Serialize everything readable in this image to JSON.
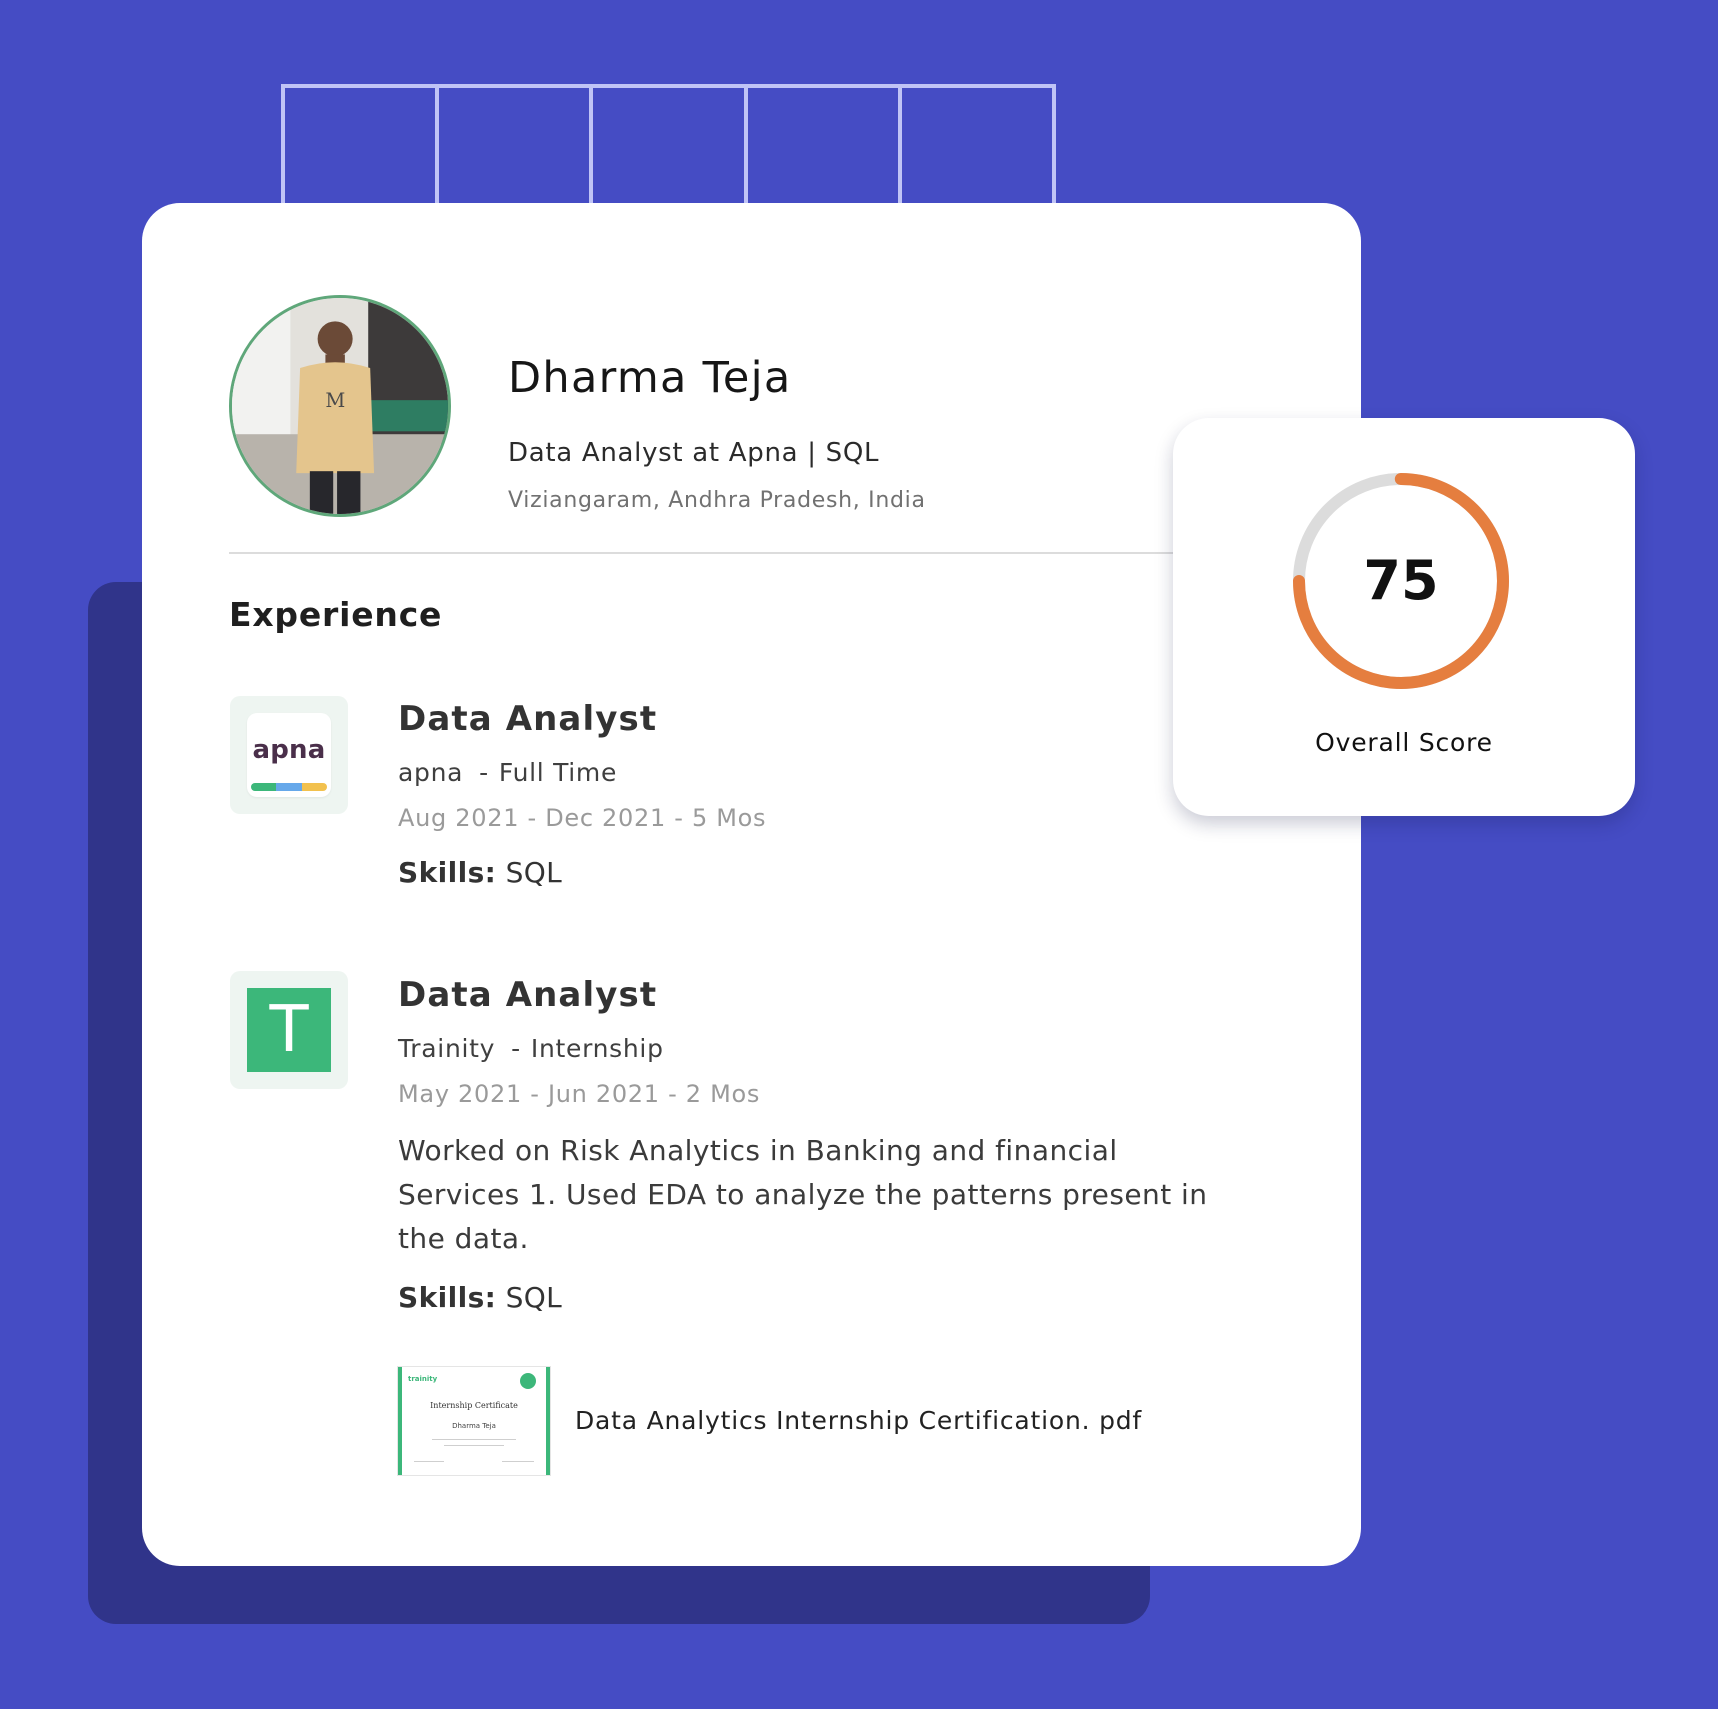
{
  "profile": {
    "name": "Dharma Teja",
    "headline": "Data Analyst at Apna | SQL",
    "location": "Viziangaram, Andhra Pradesh, India"
  },
  "experience": {
    "heading": "Experience",
    "items": [
      {
        "title": "Data Analyst",
        "company": "apna",
        "type": "Full Time",
        "dates": "Aug 2021 - Dec 2021 - 5 Mos",
        "skills_label": "Skills:",
        "skills": "SQL",
        "logo": {
          "name": "apna-logo",
          "text": "apna",
          "strip_colors": [
            "#3cb77a",
            "#66a8ea",
            "#f2c14e"
          ]
        }
      },
      {
        "title": "Data Analyst",
        "company": "Trainity",
        "type": "Internship",
        "dates": "May 2021 - Jun 2021 - 2 Mos",
        "description": "Worked on Risk Analytics in Banking and financial Services 1. Used EDA to analyze the patterns present in the data.",
        "skills_label": "Skills:",
        "skills": "SQL",
        "logo": {
          "name": "trainity-logo",
          "text": "T",
          "color": "#3cb77a"
        },
        "attachment": {
          "filename": "Data Analytics Internship Certification. pdf",
          "thumbnail": {
            "brand": "trainity",
            "title": "Internship Certificate",
            "name": "Dharma Teja"
          }
        }
      }
    ]
  },
  "score": {
    "value": "75",
    "fraction": 0.75,
    "label": "Overall Score",
    "ring_color": "#e57e3f",
    "track_color": "#dcdcdc"
  },
  "colors": {
    "background": "#454cc4",
    "shadow_panel": "#30348a",
    "card": "#ffffff",
    "accent_green": "#3cb77a"
  }
}
